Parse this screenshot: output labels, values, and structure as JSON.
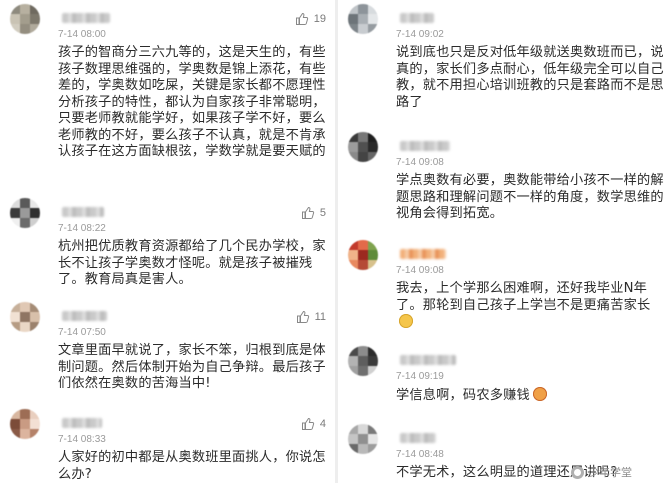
{
  "left_column": [
    {
      "time": "7-14 08:00",
      "likes": "19",
      "text": "孩子的智商分三六九等的，这是天生的，有些孩子数理思维强的，学奥数是锦上添花，有些差的，学奥数如吃屎，关键是家长都不愿理性分析孩子的特性，都认为自家孩子非常聪明，只要老师教就能学好，如果孩子学不好，要么老师教的不好，要么孩子不认真，就是不肯承认孩子在这方面缺根弦，学数学就是要天赋的",
      "avatar_colors": [
        "#8e8a7e",
        "#b7b0a0",
        "#6f6a60",
        "#c9c3b4",
        "#a39d8d",
        "#7d786c",
        "#d2cdc0",
        "#948e80",
        "#b0aa9c"
      ]
    },
    {
      "time": "7-14 08:22",
      "likes": "5",
      "text": "杭州把优质教育资源都给了几个民办学校，家长不让孩子学奥数才怪呢。就是孩子被摧残了。教育局真是害人。",
      "avatar_colors": [
        "#dcdcdc",
        "#5a5a5a",
        "#e8e8e8",
        "#3c3c3c",
        "#9a9a9a",
        "#2f2f2f",
        "#f0f0f0",
        "#6b6b6b",
        "#cfcfcf"
      ]
    },
    {
      "time": "7-14 07:50",
      "likes": "11",
      "text": "文章里面早就说了，家长不笨，归根到底是体制问题。然后体制开始为自己争辩。最后孩子们依然在奥数的苦海当中!",
      "avatar_colors": [
        "#c7b09a",
        "#e0c8b4",
        "#a58c76",
        "#f1e1d3",
        "#8f7563",
        "#d8c0aa",
        "#b69c84",
        "#ead7c6",
        "#9b826d"
      ]
    },
    {
      "time": "7-14 08:33",
      "likes": "4",
      "text": "人家好的初中都是从奥数班里面挑人，你说怎么办?",
      "avatar_colors": [
        "#d8b7a0",
        "#9d6d55",
        "#e9cfbf",
        "#7c4c39",
        "#c99b83",
        "#f3e0d4",
        "#8a5a46",
        "#dcb49e",
        "#b58269"
      ]
    }
  ],
  "right_column": [
    {
      "time": "7-14 09:02",
      "likes": "",
      "text": "说到底也只是反对低年级就送奥数班而已，说真的，家长们多点耐心，低年级完全可以自己教，就不用担心培训班教的只是套路而不是思路了",
      "avatar_colors": [
        "#bfc4c8",
        "#8d949a",
        "#d7dbde",
        "#6d7479",
        "#a9afb4",
        "#e4e7e9",
        "#7e858a",
        "#c8ccd0",
        "#969ca1"
      ]
    },
    {
      "time": "7-14 09:08",
      "likes": "",
      "text": "学点奥数有必要，奥数能带给小孩不一样的解题思路和理解问题不一样的角度，数学思维的视角会得到拓宽。",
      "avatar_colors": [
        "#3a3a3a",
        "#777777",
        "#1f1f1f",
        "#9c9c9c",
        "#505050",
        "#2a2a2a",
        "#8a8a8a",
        "#444444",
        "#666666"
      ]
    },
    {
      "time": "7-14 09:08",
      "likes": "",
      "text": "我去，上个学那么困难啊，还好我毕业N年了。那轮到自己孩子上学岂不是更痛苦家长",
      "emoji": "neutral",
      "avatar_colors": [
        "#c23a2c",
        "#e36a4a",
        "#7fa34e",
        "#f0b38a",
        "#9c2a20",
        "#5e8c3a",
        "#e8895f",
        "#b54a36",
        "#d7c18c"
      ]
    },
    {
      "time": "7-14 09:19",
      "likes": "",
      "text": "学信息啊，码农多赚钱",
      "emoji": "grin",
      "avatar_colors": [
        "#4a4a4a",
        "#8c8c8c",
        "#2c2c2c",
        "#b3b3b3",
        "#5e5e5e",
        "#3b3b3b",
        "#a0a0a0",
        "#6f6f6f",
        "#d0d0d0"
      ]
    },
    {
      "time": "7-14 08:48",
      "likes": "",
      "text": "不学无术，这么明显的道理还用讲吗?",
      "avatar_colors": [
        "#a8a8a8",
        "#d8d8d8",
        "#7a7a7a",
        "#c5c5c5",
        "#909090",
        "#e6e6e6",
        "#6a6a6a",
        "#b9b9b9",
        "#9d9d9d"
      ]
    }
  ],
  "watermark": {
    "text": "少年学堂",
    "icon": "wechat-logo-icon"
  },
  "icons": {
    "like": "thumbs-up-icon"
  },
  "colors": {
    "text": "#2b2b2b",
    "time": "#9a9a9a",
    "like": "#7a7a7a",
    "background": "#ffffff"
  }
}
